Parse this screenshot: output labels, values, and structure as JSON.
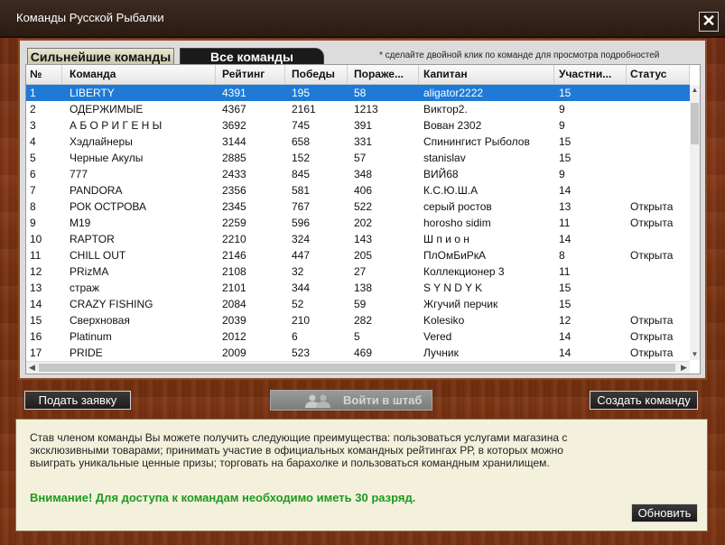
{
  "window": {
    "title": "Команды Русской Рыбалки",
    "close_symbol": "✕"
  },
  "tabs": [
    {
      "label": "Сильнейшие команды",
      "active": true
    },
    {
      "label": "Все команды",
      "active": false
    }
  ],
  "hint": "* сделайте двойной клик по команде для просмотра подробностей",
  "table": {
    "columns": [
      "№",
      "Команда",
      "Рейтинг",
      "Победы",
      "Пораже...",
      "Капитан",
      "Участни...",
      "Статус"
    ],
    "rows": [
      [
        "1",
        "LIBERTY",
        "4391",
        "195",
        "58",
        "aligator2222",
        "15",
        ""
      ],
      [
        "2",
        "ОДЕРЖИМЫЕ",
        "4367",
        "2161",
        "1213",
        "Виктор2.",
        "9",
        ""
      ],
      [
        "3",
        "А Б О Р И Г Е Н Ы",
        "3692",
        "745",
        "391",
        "Вован 2302",
        "9",
        ""
      ],
      [
        "4",
        "Хэдлайнеры",
        "3144",
        "658",
        "331",
        "Спинингист Рыболов",
        "15",
        ""
      ],
      [
        "5",
        "Черные Акулы",
        "2885",
        "152",
        "57",
        "stanislav",
        "15",
        ""
      ],
      [
        "6",
        "777",
        "2433",
        "845",
        "348",
        "ВИЙ68",
        "9",
        ""
      ],
      [
        "7",
        "PANDORA",
        "2356",
        "581",
        "406",
        "К.С.Ю.Ш.А",
        "14",
        ""
      ],
      [
        "8",
        "РОК ОСТРОВА",
        "2345",
        "767",
        "522",
        "серый ростов",
        "13",
        "Открыта"
      ],
      [
        "9",
        "M19",
        "2259",
        "596",
        "202",
        "horosho sidim",
        "11",
        "Открыта"
      ],
      [
        "10",
        "RAPTOR",
        "2210",
        "324",
        "143",
        "Ш п и о н",
        "14",
        ""
      ],
      [
        "11",
        "CHILL OUT",
        "2146",
        "447",
        "205",
        "ПлОмБиРкА",
        "8",
        "Открыта"
      ],
      [
        "12",
        "PRizMA",
        "2108",
        "32",
        "27",
        "Коллекционер 3",
        "11",
        ""
      ],
      [
        "13",
        "страж",
        "2101",
        "344",
        "138",
        "S Y N D Y K",
        "15",
        ""
      ],
      [
        "14",
        "CRAZY FISHING",
        "2084",
        "52",
        "59",
        "Жгучий перчик",
        "15",
        ""
      ],
      [
        "15",
        "Сверхновая",
        "2039",
        "210",
        "282",
        "Kolesiko",
        "12",
        "Открыта"
      ],
      [
        "16",
        "Platinum",
        "2012",
        "6",
        "5",
        "Vered",
        "14",
        "Открыта"
      ],
      [
        "17",
        "PRIDE",
        "2009",
        "523",
        "469",
        "Лучник",
        "14",
        "Открыта"
      ]
    ],
    "selected_row": 0
  },
  "buttons": {
    "apply": "Подать заявку",
    "hq": "Войти в штаб",
    "create": "Создать команду",
    "refresh": "Обновить"
  },
  "info": {
    "text": "Став членом команды Вы можете получить следующие преимущества: пользоваться услугами магазина с эксклюзивными товарами; принимать участие в официальных командных рейтингах РР, в которых можно выиграть уникальные ценные призы; торговать на барахолке и пользоваться командным хранилищем.",
    "warning": "Внимание! Для доступа к командам необходимо иметь 30 разряд."
  },
  "colors": {
    "selected_row": "#1e7ad6",
    "warning_text": "#1f9a1f",
    "wood": "#7a3314"
  }
}
